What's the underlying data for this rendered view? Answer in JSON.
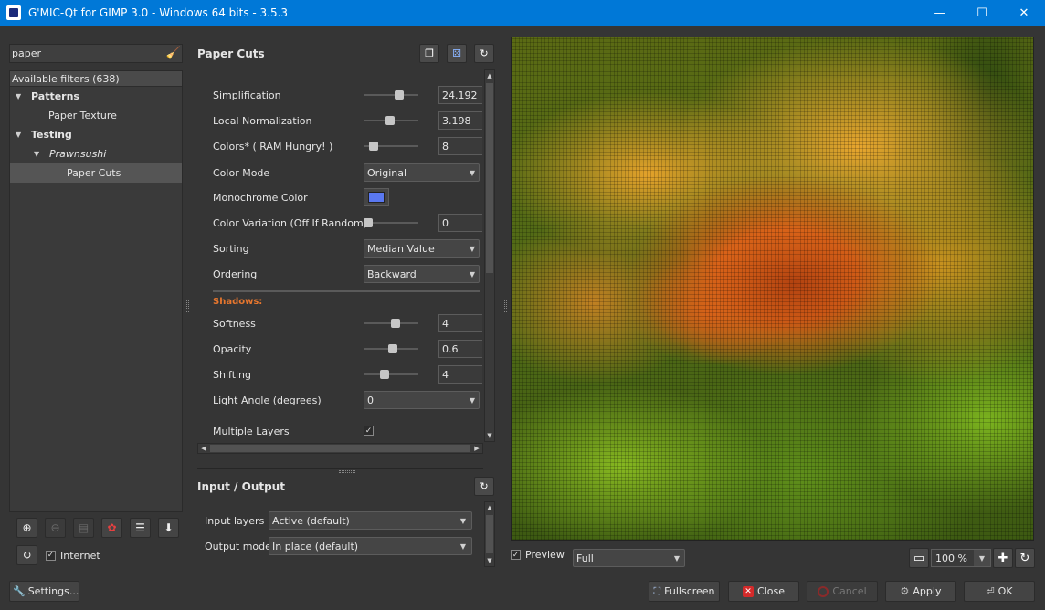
{
  "window": {
    "title": "G'MIC-Qt for GIMP 3.0 - Windows 64 bits - 3.5.3",
    "minimize": "—",
    "maximize": "☐",
    "close": "✕"
  },
  "search": {
    "value": "paper",
    "clear_glyph": "🧹"
  },
  "tree": {
    "header": "Available filters (638)",
    "items": [
      {
        "label": "Patterns"
      },
      {
        "label": "Paper Texture"
      },
      {
        "label": "Testing"
      },
      {
        "label": "Prawnsushi"
      },
      {
        "label": "Paper Cuts"
      }
    ]
  },
  "left_footer": {
    "internet_label": "Internet",
    "internet_checked": "✓"
  },
  "filter": {
    "title": "Paper Cuts",
    "params": {
      "simplification": {
        "label": "Simplification",
        "value": "24.192"
      },
      "local_norm": {
        "label": "Local Normalization",
        "value": "3.198"
      },
      "colors": {
        "label": "Colors* ( RAM Hungry! )",
        "value": "8"
      },
      "color_mode": {
        "label": "Color Mode",
        "value": "Original"
      },
      "mono_color": {
        "label": "Monochrome Color",
        "color": "#5a78f0"
      },
      "color_variation": {
        "label": "Color Variation (Off If Random)",
        "value": "0"
      },
      "sorting": {
        "label": "Sorting",
        "value": "Median Value"
      },
      "ordering": {
        "label": "Ordering",
        "value": "Backward"
      },
      "shadows_section": "Shadows:",
      "softness": {
        "label": "Softness",
        "value": "4"
      },
      "opacity": {
        "label": "Opacity",
        "value": "0.6"
      },
      "shifting": {
        "label": "Shifting",
        "value": "4"
      },
      "light_angle": {
        "label": "Light Angle (degrees)",
        "value": "0"
      },
      "multiple_layers": {
        "label": "Multiple Layers",
        "checked": "✓"
      }
    }
  },
  "io": {
    "title": "Input / Output",
    "input_label": "Input layers",
    "input_value": "Active (default)",
    "output_label": "Output mode",
    "output_value": "In place (default)"
  },
  "preview": {
    "checkbox_label": "Preview",
    "checked": "✓",
    "mode": "Full",
    "zoom": "100 %"
  },
  "buttons": {
    "settings": "Settings...",
    "fullscreen": "Fullscreen",
    "close": "Close",
    "cancel": "Cancel",
    "apply": "Apply",
    "ok": "OK"
  },
  "colors": {
    "accent_orange": "#e8772e",
    "titlebar_blue": "#0078d7"
  }
}
